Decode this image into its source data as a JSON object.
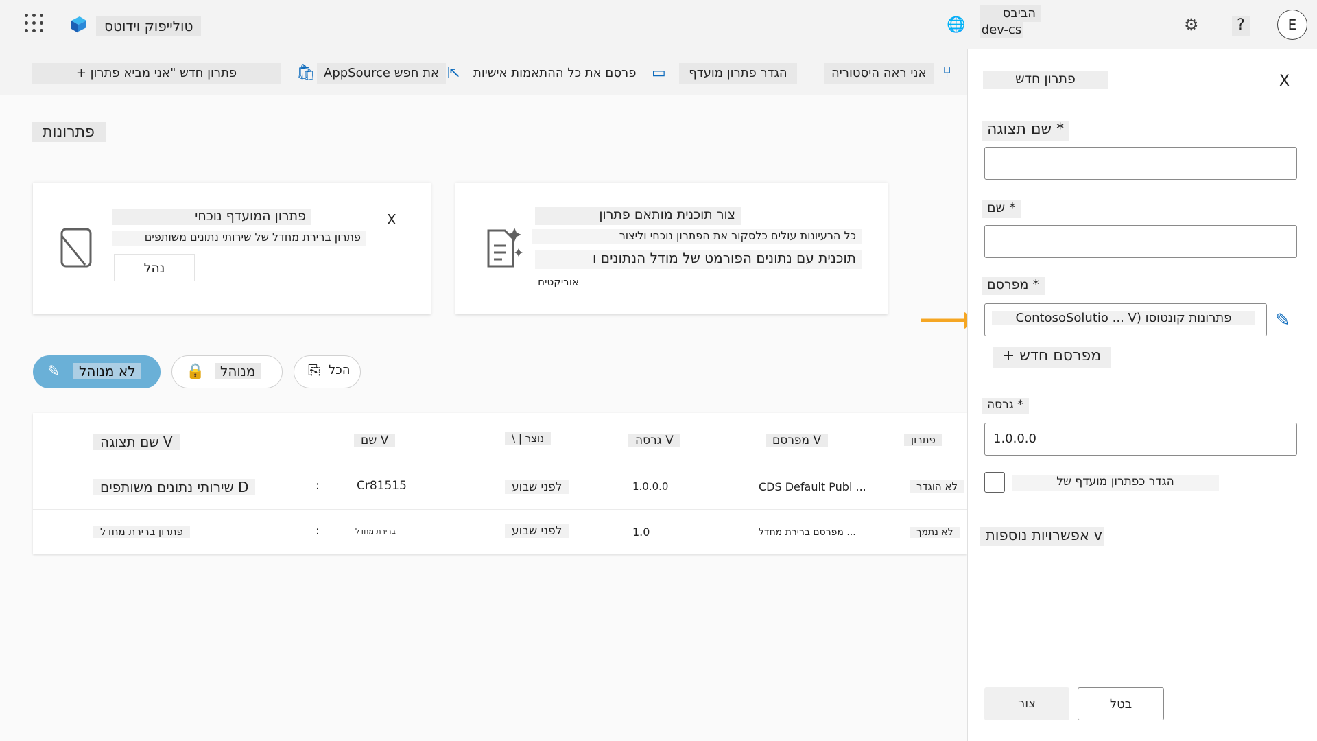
{
  "header": {
    "app_name": "טולייפוק וידוטס",
    "env_line1": "הביבס",
    "env_line2": "dev-cs",
    "avatar_initial": "E",
    "help_label": "?"
  },
  "commandbar": {
    "new_solution": "+ פתרון חדש \"אני מביא פתרון",
    "appsource": "AppSource את חפש",
    "publish_all": "פרסם את כל ההתאמות אישיות",
    "upgrade": "הגדר פתרון מועדף",
    "history": "אני ראה היסטוריה"
  },
  "page": {
    "title": "פתרונות"
  },
  "cards": {
    "preferred": {
      "title": "פתרון המועדף נוכחי",
      "desc": "פתרון ברירת מחדל של שירותי נתונים משותפים",
      "manage": "נהל",
      "close": "X"
    },
    "copilot": {
      "title": "צור תוכנית מותאם פתרון",
      "desc": "כל הרעיונות עולים כלסקור את הפתרון נוכחי וליצור",
      "desc2": "תוכנית עם נתונים הפורמט של מודל הנתונים ו",
      "desc3": "אוביקטים"
    }
  },
  "filters": {
    "managed_not": "לא מנוהל",
    "managed": "מנוהל",
    "all": "הכל"
  },
  "table": {
    "headers": {
      "display_name": "שם תצוגה V",
      "name": "שם V",
      "created": "\\ | נוצר",
      "version": "גרסה V",
      "publisher": "מפרסם V",
      "managed": "פתרון"
    },
    "rows": [
      {
        "display_name": "שירותי נתונים משותפים D",
        "menu": ":",
        "name": "Cr81515",
        "created": "לפני שבוע",
        "version": "1.0.0.0",
        "publisher": "CDS Default Publ ...",
        "managed": "לא הוגדר"
      },
      {
        "display_name": "פתרון ברירת מחדל",
        "menu": ":",
        "name": "ברירת מחדל",
        "created": "לפני שבוע",
        "version": "1.0",
        "publisher": "מפרסם ברירת מחדל ...",
        "managed": "לא נתמך"
      }
    ]
  },
  "panel": {
    "title": "פתרון חדש",
    "close": "X",
    "display_name_label": "* שם תצוגה",
    "name_label": "* שם",
    "publisher_label": "* מפרסם",
    "publisher_value": "ContosoSolutio ... V) פתרונות קונטוסו",
    "new_publisher": "+ מפרסם חדש",
    "version_label": "* גרסה",
    "version_value": "1.0.0.0",
    "preferred_checkbox": "הגדר כפתרון מועדף של",
    "more_options": "אפשרויות נוספות v",
    "create": "צור",
    "cancel": "בטל"
  },
  "colors": {
    "accent": "#0f6cbd",
    "active_pill": "#6ab0d7",
    "arrow": "#f5a623"
  }
}
